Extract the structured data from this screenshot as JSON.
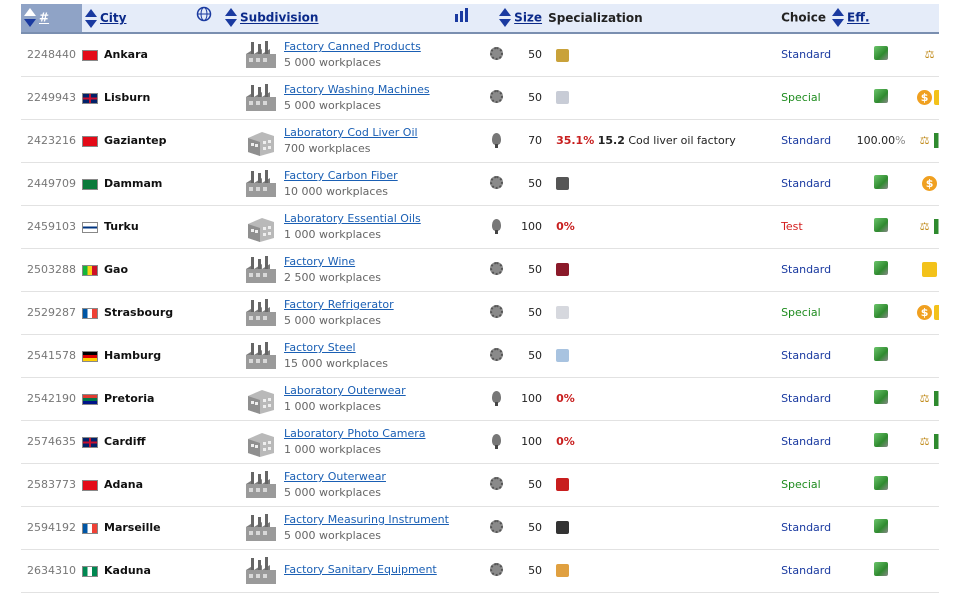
{
  "header": {
    "num": "#",
    "city": "City",
    "subdivision": "Subdivision",
    "size": "Size",
    "specialization": "Specialization",
    "choice": "Choice",
    "eff": "Eff."
  },
  "colors": {
    "header_bg": "#e5ecf9",
    "link": "#1a5fb4",
    "pct_red": "#c81e1e",
    "special_green": "#1f8c1f",
    "test_red": "#d42020"
  },
  "rows": [
    {
      "id": "2248440",
      "flag": "turkey",
      "city": "Ankara",
      "type": "factory",
      "name": "Factory Canned Products",
      "workplaces": "5 000 workplaces",
      "tech": "gear",
      "size": "50",
      "product": "canned-products-icon",
      "pct": "",
      "level": "",
      "desc": "",
      "choice": "Standard",
      "eff": "",
      "icons": [
        "scales"
      ]
    },
    {
      "id": "2249943",
      "flag": "uk",
      "city": "Lisburn",
      "type": "factory",
      "name": "Factory Washing Machines",
      "workplaces": "5 000 workplaces",
      "tech": "gear",
      "size": "50",
      "product": "washing-machine-icon",
      "pct": "",
      "level": "",
      "desc": "",
      "choice": "Special",
      "eff": "",
      "icons": [
        "dollar",
        "box"
      ]
    },
    {
      "id": "2423216",
      "flag": "turkey",
      "city": "Gaziantep",
      "type": "lab",
      "name": "Laboratory Cod Liver Oil",
      "workplaces": "700 workplaces",
      "tech": "bulb",
      "size": "70",
      "product": "",
      "pct": "35.1%",
      "level": "15.2",
      "desc": "Cod liver oil factory",
      "choice": "Standard",
      "eff": "100.00",
      "icons": [
        "scales",
        "books"
      ]
    },
    {
      "id": "2449709",
      "flag": "saudi",
      "city": "Dammam",
      "type": "factory",
      "name": "Factory Carbon Fiber",
      "workplaces": "10 000 workplaces",
      "tech": "gear",
      "size": "50",
      "product": "carbon-fiber-icon",
      "pct": "",
      "level": "",
      "desc": "",
      "choice": "Standard",
      "eff": "",
      "icons": [
        "dollar"
      ]
    },
    {
      "id": "2459103",
      "flag": "finland",
      "city": "Turku",
      "type": "lab",
      "name": "Laboratory Essential Oils",
      "workplaces": "1 000 workplaces",
      "tech": "bulb",
      "size": "100",
      "product": "",
      "pct": "0%",
      "level": "",
      "desc": "",
      "choice": "Test",
      "eff": "",
      "icons": [
        "scales",
        "books"
      ]
    },
    {
      "id": "2503288",
      "flag": "mali",
      "city": "Gao",
      "type": "factory",
      "name": "Factory Wine",
      "workplaces": "2 500 workplaces",
      "tech": "gear",
      "size": "50",
      "product": "wine-icon",
      "pct": "",
      "level": "",
      "desc": "",
      "choice": "Standard",
      "eff": "",
      "icons": [
        "box"
      ]
    },
    {
      "id": "2529287",
      "flag": "france",
      "city": "Strasbourg",
      "type": "factory",
      "name": "Factory Refrigerator",
      "workplaces": "5 000 workplaces",
      "tech": "gear",
      "size": "50",
      "product": "refrigerator-icon",
      "pct": "",
      "level": "",
      "desc": "",
      "choice": "Special",
      "eff": "",
      "icons": [
        "dollar",
        "box"
      ]
    },
    {
      "id": "2541578",
      "flag": "germany",
      "city": "Hamburg",
      "type": "factory",
      "name": "Factory Steel",
      "workplaces": "15 000 workplaces",
      "tech": "gear",
      "size": "50",
      "product": "steel-icon",
      "pct": "",
      "level": "",
      "desc": "",
      "choice": "Standard",
      "eff": "",
      "icons": []
    },
    {
      "id": "2542190",
      "flag": "southafrica",
      "city": "Pretoria",
      "type": "lab",
      "name": "Laboratory Outerwear",
      "workplaces": "1 000 workplaces",
      "tech": "bulb",
      "size": "100",
      "product": "",
      "pct": "0%",
      "level": "",
      "desc": "",
      "choice": "Standard",
      "eff": "",
      "icons": [
        "scales",
        "books"
      ]
    },
    {
      "id": "2574635",
      "flag": "uk",
      "city": "Cardiff",
      "type": "lab",
      "name": "Laboratory Photo Camera",
      "workplaces": "1 000 workplaces",
      "tech": "bulb",
      "size": "100",
      "product": "",
      "pct": "0%",
      "level": "",
      "desc": "",
      "choice": "Standard",
      "eff": "",
      "icons": [
        "scales",
        "books"
      ]
    },
    {
      "id": "2583773",
      "flag": "turkey",
      "city": "Adana",
      "type": "factory",
      "name": "Factory Outerwear",
      "workplaces": "5 000 workplaces",
      "tech": "gear",
      "size": "50",
      "product": "outerwear-icon",
      "pct": "",
      "level": "",
      "desc": "",
      "choice": "Special",
      "eff": "",
      "icons": []
    },
    {
      "id": "2594192",
      "flag": "france",
      "city": "Marseille",
      "type": "factory",
      "name": "Factory Measuring Instrument",
      "workplaces": "5 000 workplaces",
      "tech": "gear",
      "size": "50",
      "product": "measuring-instrument-icon",
      "pct": "",
      "level": "",
      "desc": "",
      "choice": "Standard",
      "eff": "",
      "icons": []
    },
    {
      "id": "2634310",
      "flag": "nigeria",
      "city": "Kaduna",
      "type": "factory",
      "name": "Factory Sanitary Equipment",
      "workplaces": "",
      "tech": "gear",
      "size": "50",
      "product": "sanitary-equipment-icon",
      "pct": "",
      "level": "",
      "desc": "",
      "choice": "Standard",
      "eff": "",
      "icons": []
    }
  ]
}
